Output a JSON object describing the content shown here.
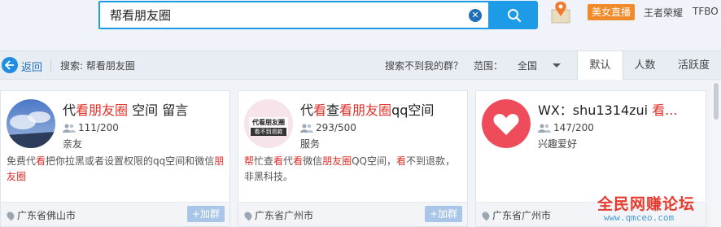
{
  "search": {
    "query": "帮看朋友圈",
    "clear_glyph": "✕"
  },
  "top_links": {
    "beauty_live": "美女直播",
    "game": "王者荣耀",
    "tfbo": "TFBO"
  },
  "nav": {
    "back_label": "返回",
    "search_crumb": "搜索: 帮看朋友圈",
    "not_found": "搜索不到我的群？",
    "range_label": "范围：",
    "range_value": "全国",
    "sort_tabs": [
      "默认",
      "人数",
      "活跃度"
    ]
  },
  "cards": [
    {
      "title_parts": [
        "代",
        "看朋友圈",
        " 空间 留言"
      ],
      "members": "111/200",
      "category": "亲友",
      "desc_parts": [
        "免费代",
        "看",
        "把你拉黑或者设置权限的qq空间和微信",
        "朋友圈"
      ],
      "location": "广东省佛山市",
      "join_label": "+加群"
    },
    {
      "title_parts": [
        "代",
        "看",
        "查",
        "看朋友圈",
        "qq空间"
      ],
      "avatar_text_1": "代看朋友圈",
      "avatar_text_2": "看不到退款",
      "members": "293/500",
      "category": "服务",
      "desc_parts": [
        "帮",
        "忙查",
        "看",
        "代",
        "看",
        "微信",
        "朋友圈",
        "QQ空间，",
        "看",
        "不到退款，非黑科技。"
      ],
      "location": "广东省广州市",
      "join_label": "+加群"
    },
    {
      "title_parts": [
        "WX：shu1314zui ",
        "看..."
      ],
      "members": "147/200",
      "category": "兴趣爱好",
      "location": "广东省广州市",
      "join_label": "+加群"
    }
  ],
  "watermark": {
    "title": "全民网赚论坛",
    "url": "www.qmceo.com"
  },
  "colors": {
    "accent": "#1e9be6",
    "highlight": "#e0302a",
    "join": "#a9c6e8"
  }
}
